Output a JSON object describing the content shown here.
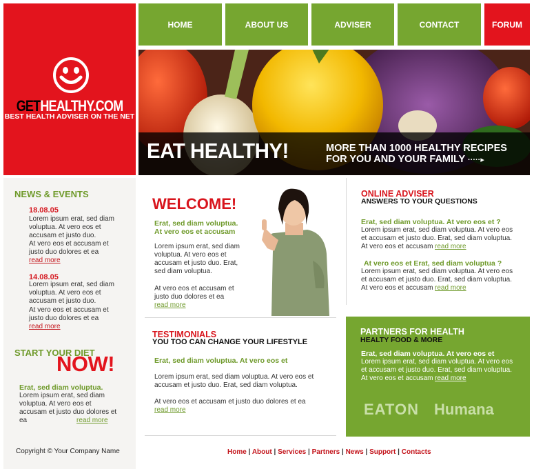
{
  "logo": {
    "get": "GET",
    "healthy": "HEALTHY.COM",
    "tagline": "BEST HEALTH ADVISER ON THE NET"
  },
  "nav": {
    "home": "HOME",
    "about": "ABOUT US",
    "adviser": "ADVISER",
    "contact": "CONTACT",
    "forum": "FORUM"
  },
  "hero": {
    "title": "EAT HEALTHY!",
    "sub1": "MORE THAN 1000 HEALTHY RECIPES",
    "sub2": "FOR YOU AND YOUR FAMILY"
  },
  "news": {
    "heading": "NEWS & EVENTS",
    "items": [
      {
        "date": "18.08.05",
        "text1": "Lorem ipsum erat, sed diam voluptua. At vero eos et accusam et justo duo.",
        "text2": "At vero eos et accusam et justo duo dolores et ea",
        "more": "read more"
      },
      {
        "date": "14.08.05",
        "text1": "Lorem ipsum erat, sed diam voluptua. At vero eos et accusam et justo duo.",
        "text2": "At vero eos et accusam et justo duo dolores et ea",
        "more": "read more"
      }
    ]
  },
  "diet": {
    "heading": "START YOUR DIET",
    "now": "NOW!",
    "lead": "Erat, sed diam voluptua.",
    "text": "Lorem ipsum erat, sed diam voluptua. At vero eos et accusam et justo duo dolores et ea",
    "more": "read more"
  },
  "copyright": "Copyright © Your Company Name",
  "welcome": {
    "heading": "WELCOME!",
    "lead1": "Erat, sed diam voluptua.",
    "lead2": "At vero eos et accusam",
    "p1": "Lorem ipsum erat, sed diam voluptua. At vero eos et accusam et justo duo. Erat, sed diam voluptua.",
    "p2": "At vero eos et accusam et justo duo dolores et ea",
    "more": "read more"
  },
  "testimonials": {
    "heading": "TESTIMONIALS",
    "sub": "YOU TOO CAN CHANGE YOUR LIFESTYLE",
    "lead": "Erat, sed diam voluptua. At vero eos et",
    "p1": "Lorem ipsum erat, sed diam voluptua. At vero eos et accusam et justo duo. Erat, sed diam voluptua.",
    "p2": "At vero eos et accusam et justo duo dolores et ea",
    "more": "read more"
  },
  "adviser": {
    "heading": "ONLINE ADVISER",
    "sub": "ANSWERS TO YOUR QUESTIONS",
    "items": [
      {
        "q": "Erat, sed diam voluptua. At vero eos et ?",
        "text": "Lorem ipsum erat, sed diam voluptua. At vero eos et accusam et justo duo. Erat, sed diam voluptua. At vero eos et accusam",
        "more": "read more"
      },
      {
        "q": "At vero eos et Erat, sed diam voluptua ?",
        "text": "Lorem ipsum erat, sed diam voluptua. At vero eos et accusam et justo duo. Erat, sed diam voluptua. At vero eos et accusam",
        "more": "read more"
      }
    ]
  },
  "partners": {
    "heading": "PARTNERS FOR HEALTH",
    "sub": "HEALTY FOOD & MORE",
    "lead": "Erat, sed diam voluptua. At vero eos et",
    "text": "Lorem ipsum erat, sed diam voluptua. At vero eos et accusam et justo duo. Erat, sed diam voluptua. At vero eos et accusam",
    "more": "read more",
    "logo1": "EATON",
    "logo2": "Humana"
  },
  "footer": {
    "home": "Home",
    "about": "About",
    "services": "Services",
    "partners": "Partners",
    "news": "News",
    "support": "Support",
    "contacts": "Contacts",
    "sep": "|"
  },
  "colors": {
    "red": "#e3141d",
    "green": "#76a630",
    "dark_green_text": "#6f9a2b"
  }
}
